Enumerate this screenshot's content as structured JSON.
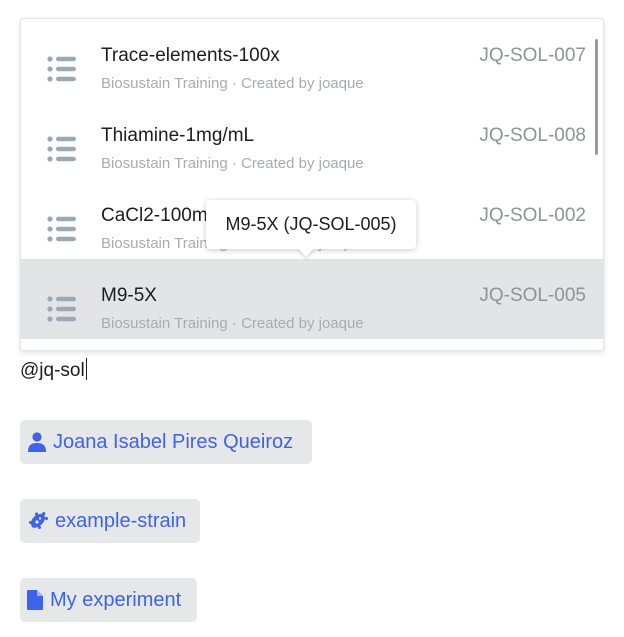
{
  "dropdown": {
    "items": [
      {
        "title": "Trace-elements-100x",
        "subtitle": "Biosustain Training · Created by joaque",
        "code": "JQ-SOL-007",
        "selected": false
      },
      {
        "title": "Thiamine-1mg/mL",
        "subtitle": "Biosustain Training · Created by joaque",
        "code": "JQ-SOL-008",
        "selected": false
      },
      {
        "title": "CaCl2-100mM",
        "subtitle": "Biosustain Training · Created by joaque",
        "code": "JQ-SOL-002",
        "selected": false
      },
      {
        "title": "M9-5X",
        "subtitle": "Biosustain Training · Created by joaque",
        "code": "JQ-SOL-005",
        "selected": true
      }
    ],
    "icon": "list-icon"
  },
  "tooltip": {
    "text": "M9-5X (JQ-SOL-005)"
  },
  "input": {
    "value": "@jq-sol"
  },
  "mentions": [
    {
      "label": "Joana Isabel Pires Queiroz",
      "icon": "user-icon"
    },
    {
      "label": "example-strain",
      "icon": "microbe-icon"
    },
    {
      "label": "My experiment",
      "icon": "document-icon"
    }
  ],
  "colors": {
    "accent": "#3d63ea",
    "icon_gray": "#9aa9b4",
    "selected_bg": "#e3e4e6",
    "chip_bg": "#e6e7e9"
  }
}
